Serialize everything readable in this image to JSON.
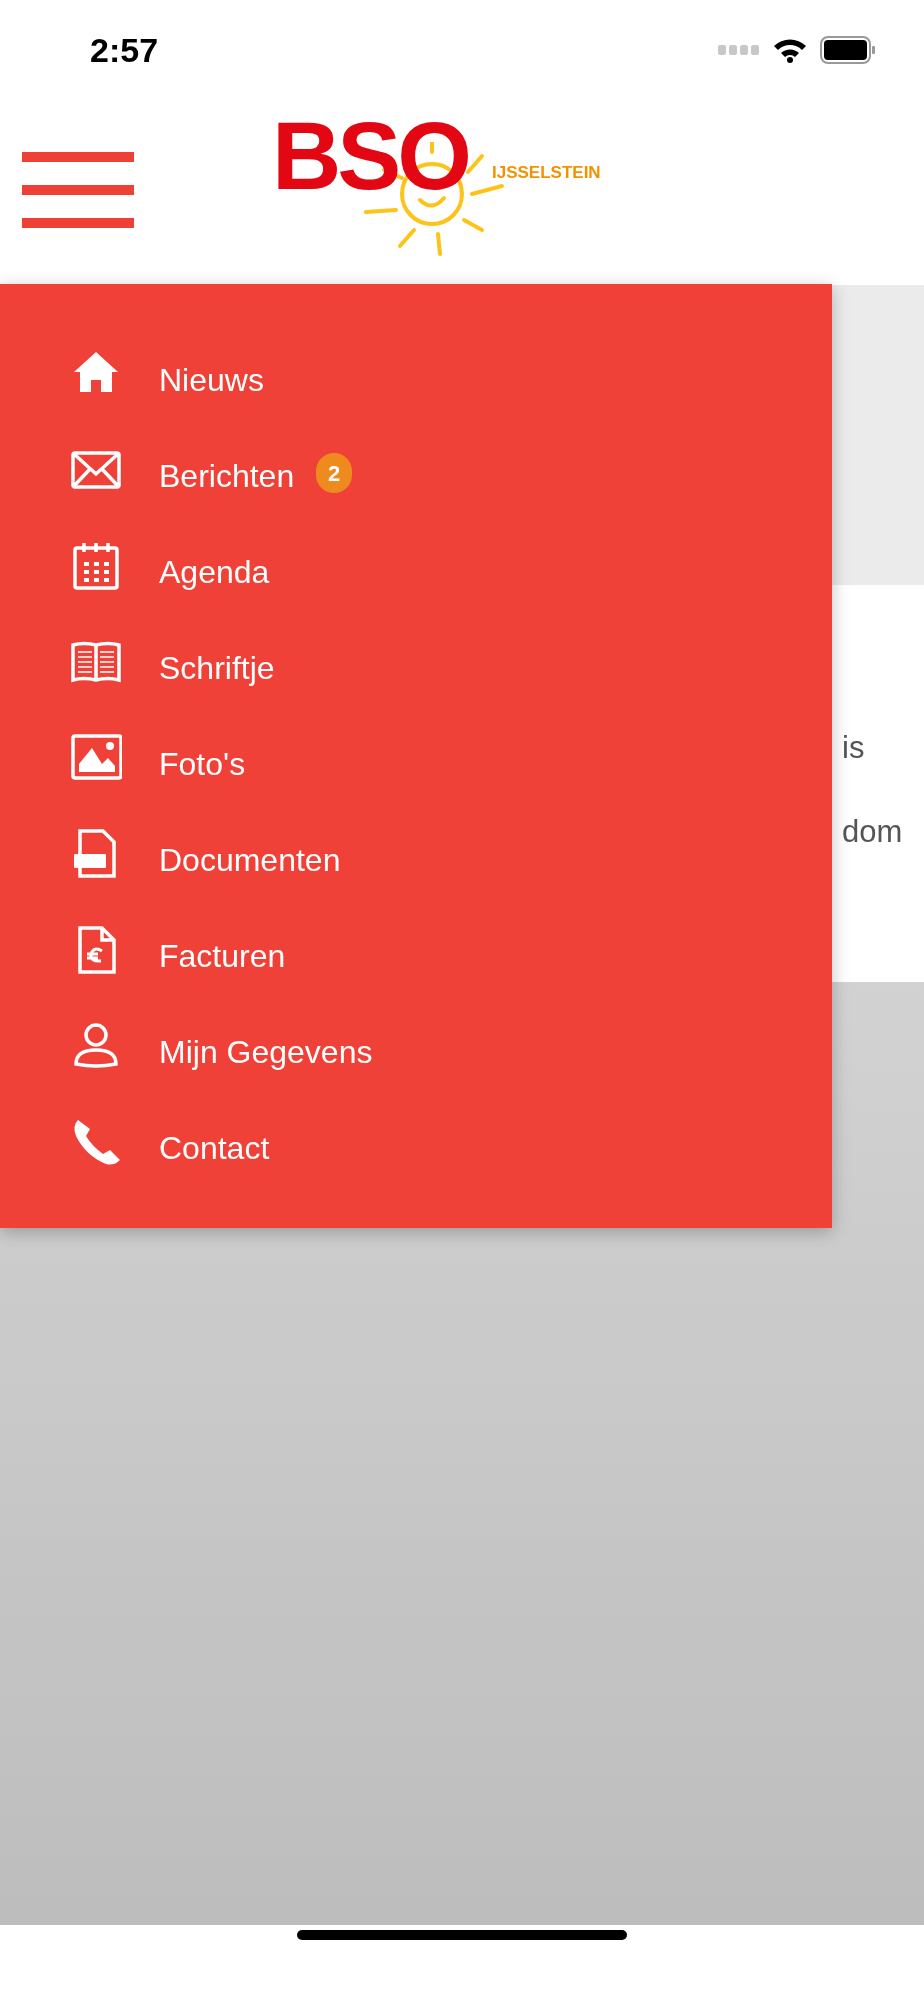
{
  "status_bar": {
    "time": "2:57"
  },
  "header": {
    "logo": {
      "name": "BSO",
      "subtitle": "IJSSELSTEIN"
    }
  },
  "background_card": {
    "lines": [
      "is",
      "dom"
    ]
  },
  "menu": {
    "items": [
      {
        "label": "Nieuws"
      },
      {
        "label": "Berichten",
        "badge": "2"
      },
      {
        "label": "Agenda"
      },
      {
        "label": "Schriftje"
      },
      {
        "label": "Foto's"
      },
      {
        "label": "Documenten"
      },
      {
        "label": "Facturen"
      },
      {
        "label": "Mijn Gegevens"
      },
      {
        "label": "Contact"
      }
    ]
  }
}
